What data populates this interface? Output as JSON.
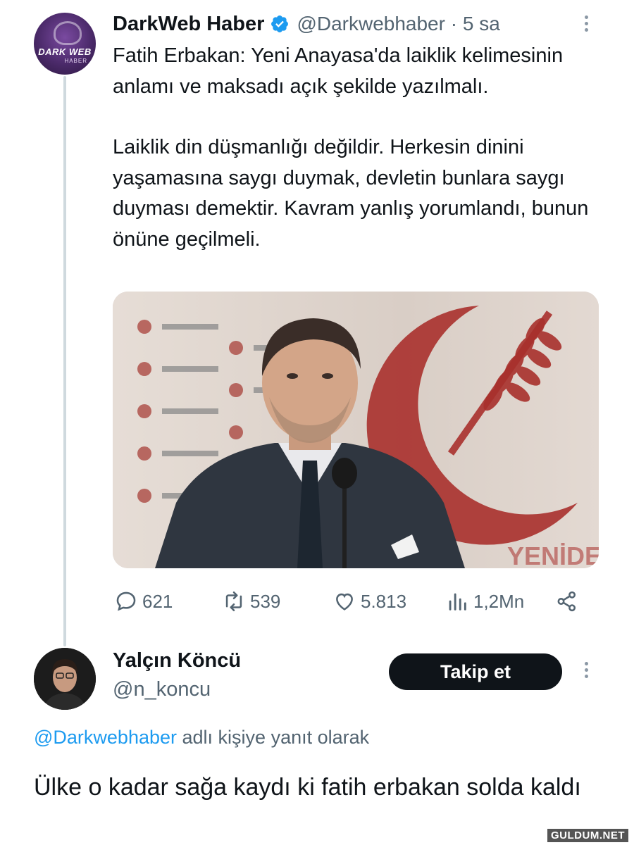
{
  "tweet": {
    "author_name": "DarkWeb Haber",
    "author_handle": "@Darkwebhaber",
    "separator": "·",
    "time": "5 sa",
    "avatar_text": "DARK WEB",
    "avatar_subtext": "HABER",
    "paragraph_1": "Fatih Erbakan: Yeni Anayasa'da laiklik kelimesinin anlamı ve maksadı açık şekilde yazılmalı.",
    "paragraph_2": "Laiklik din düşmanlığı değildir. Herkesin dinini yaşamasına saygı duymak, devletin bunlara saygı duyması demektir. Kavram yanlış yorumlandı, bunun önüne geçilmeli.",
    "image_backdrop_text": "YENİDEN REFAH",
    "stats": {
      "replies": "621",
      "retweets": "539",
      "likes": "5.813",
      "views": "1,2Mn"
    }
  },
  "reply": {
    "author_name": "Yalçın Köncü",
    "author_handle": "@n_koncu",
    "follow_label": "Takip et",
    "reply_to_mention": "@Darkwebhaber",
    "reply_to_suffix": " adlı kişiye yanıt olarak",
    "text": "Ülke o kadar sağa kaydı ki fatih erbakan solda kaldı"
  },
  "watermark": "GULDUM.NET",
  "colors": {
    "text": "#0f1419",
    "secondary": "#536471",
    "link": "#1d9bf0",
    "verified": "#1d9bf0",
    "button": "#0f1419",
    "thread_line": "#cfd9de"
  },
  "icons": {
    "reply": "speech-bubble-icon",
    "retweet": "retweet-icon",
    "like": "heart-icon",
    "views": "bar-chart-icon",
    "share": "share-icon",
    "more": "more-vertical-icon",
    "verified": "verified-badge-icon"
  }
}
